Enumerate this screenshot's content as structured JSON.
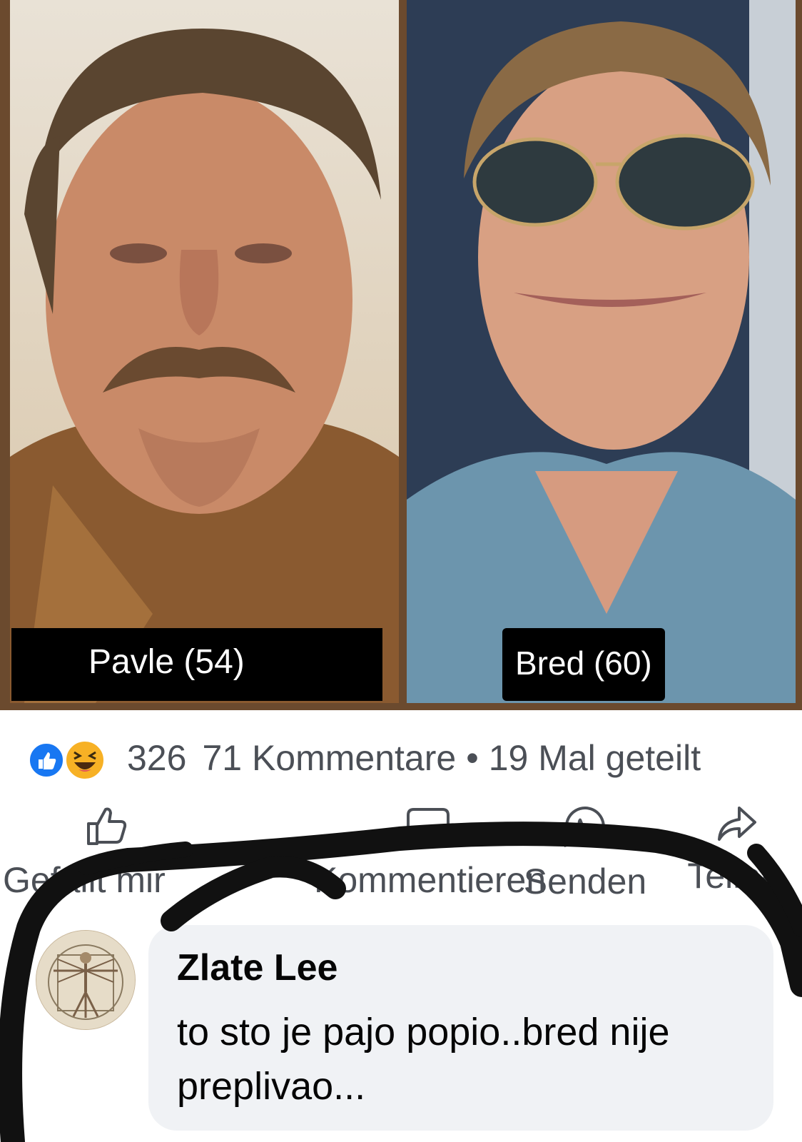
{
  "post": {
    "captions": {
      "left": "Pavle (54)",
      "right": "Bred (60)"
    },
    "reaction_count": "326",
    "comments_count": "71 Kommentare",
    "separator": "•",
    "shares": "19 Mal geteilt"
  },
  "actions": {
    "like": "Gefällt mir",
    "comment": "Kommentieren",
    "send": "Senden",
    "share": "Teilen"
  },
  "comment": {
    "author": "Zlate Lee",
    "text": "to sto je pajo popio..bred nije preplivao..."
  },
  "colors": {
    "like_blue": "#1877f2",
    "haha_yellow": "#f7b125",
    "bubble_bg": "#f0f2f5",
    "scribble": "#111111"
  },
  "icons": [
    "like-reaction-icon",
    "haha-reaction-icon",
    "thumbs-up-icon",
    "comment-icon",
    "whatsapp-icon",
    "share-arrow-icon"
  ]
}
